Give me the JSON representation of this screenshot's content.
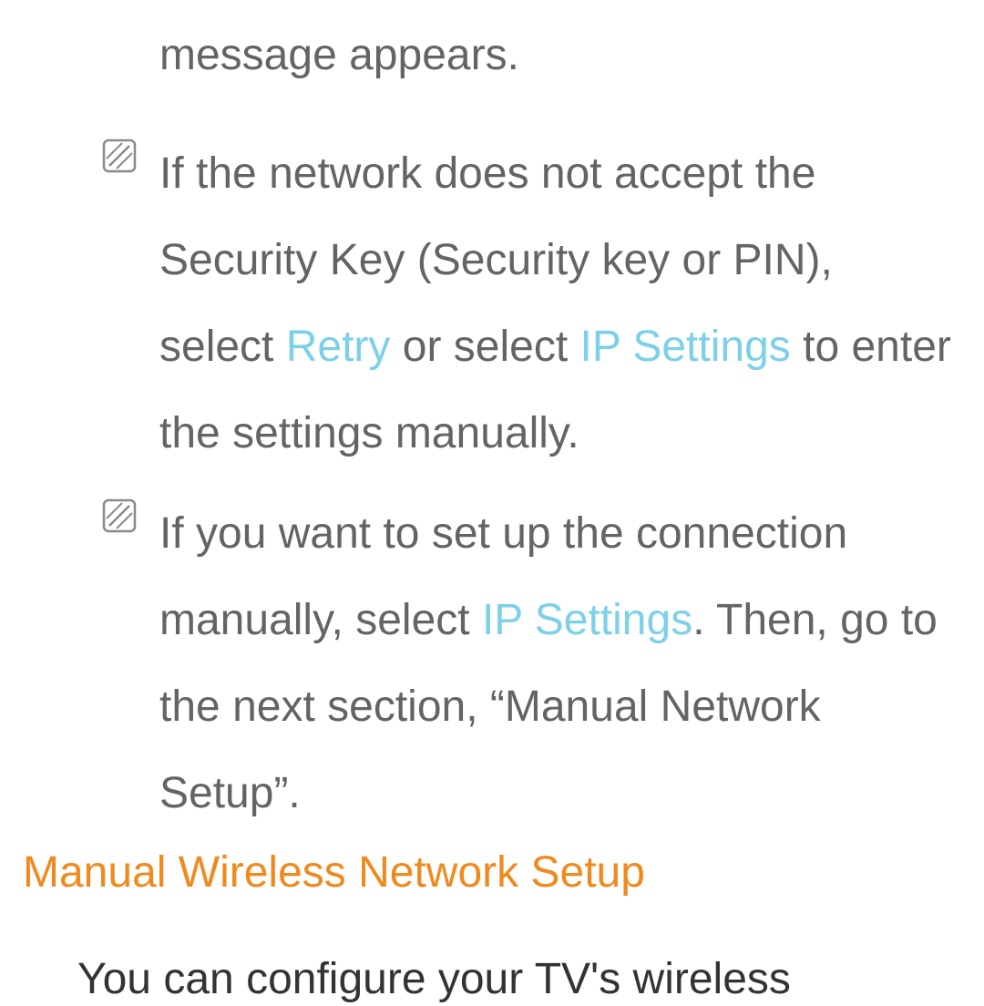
{
  "line0": "message appears.",
  "note1": {
    "t1": "If the network does not accept the Security Key (Security key or PIN), select ",
    "retry": "Retry",
    "t2": " or select ",
    "ip": "IP Settings",
    "t3": " to enter the settings manually."
  },
  "note2": {
    "t1": "If you want to set up the connection manually, select ",
    "ip": "IP Settings",
    "t2": ". Then, go to the next section, “Manual Network Setup”."
  },
  "heading": "Manual Wireless Network Setup",
  "body2": "You can configure your TV's wireless"
}
